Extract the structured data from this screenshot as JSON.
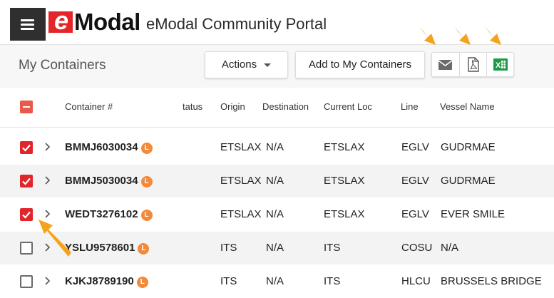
{
  "header": {
    "logo_e": "e",
    "logo_text": "Modal",
    "title": "eModal Community Portal",
    "brand_color": "#e4262b"
  },
  "toolbar": {
    "page_title": "My Containers",
    "actions_label": "Actions",
    "add_label": "Add to My Containers",
    "export_icons": [
      "email-icon",
      "pdf-icon",
      "excel-icon"
    ]
  },
  "table": {
    "columns": [
      "Container #",
      "tatus",
      "Origin",
      "Destination",
      "Current Loc",
      "Line",
      "Vessel Name"
    ],
    "badge_text": "L",
    "rows": [
      {
        "checked": true,
        "container": "BMMJ6030034",
        "origin": "ETSLAX",
        "destination": "N/A",
        "current_loc": "ETSLAX",
        "line": "EGLV",
        "vessel": "GUDRMAE"
      },
      {
        "checked": true,
        "container": "BMMJ5030034",
        "origin": "ETSLAX",
        "destination": "N/A",
        "current_loc": "ETSLAX",
        "line": "EGLV",
        "vessel": "GUDRMAE"
      },
      {
        "checked": true,
        "container": "WEDT3276102",
        "origin": "ETSLAX",
        "destination": "N/A",
        "current_loc": "ETSLAX",
        "line": "EGLV",
        "vessel": "EVER SMILE"
      },
      {
        "checked": false,
        "container": "YSLU9578601",
        "origin": "ITS",
        "destination": "N/A",
        "current_loc": "ITS",
        "line": "COSU",
        "vessel": "N/A"
      },
      {
        "checked": false,
        "container": "KJKJ8789190",
        "origin": "ITS",
        "destination": "N/A",
        "current_loc": "ITS",
        "line": "HLCU",
        "vessel": "BRUSSELS BRIDGE"
      }
    ]
  },
  "colors": {
    "accent": "#e0262b",
    "badge": "#f28a3c",
    "excel_green": "#1e9a47",
    "annotation_arrow": "#f4a41c"
  }
}
